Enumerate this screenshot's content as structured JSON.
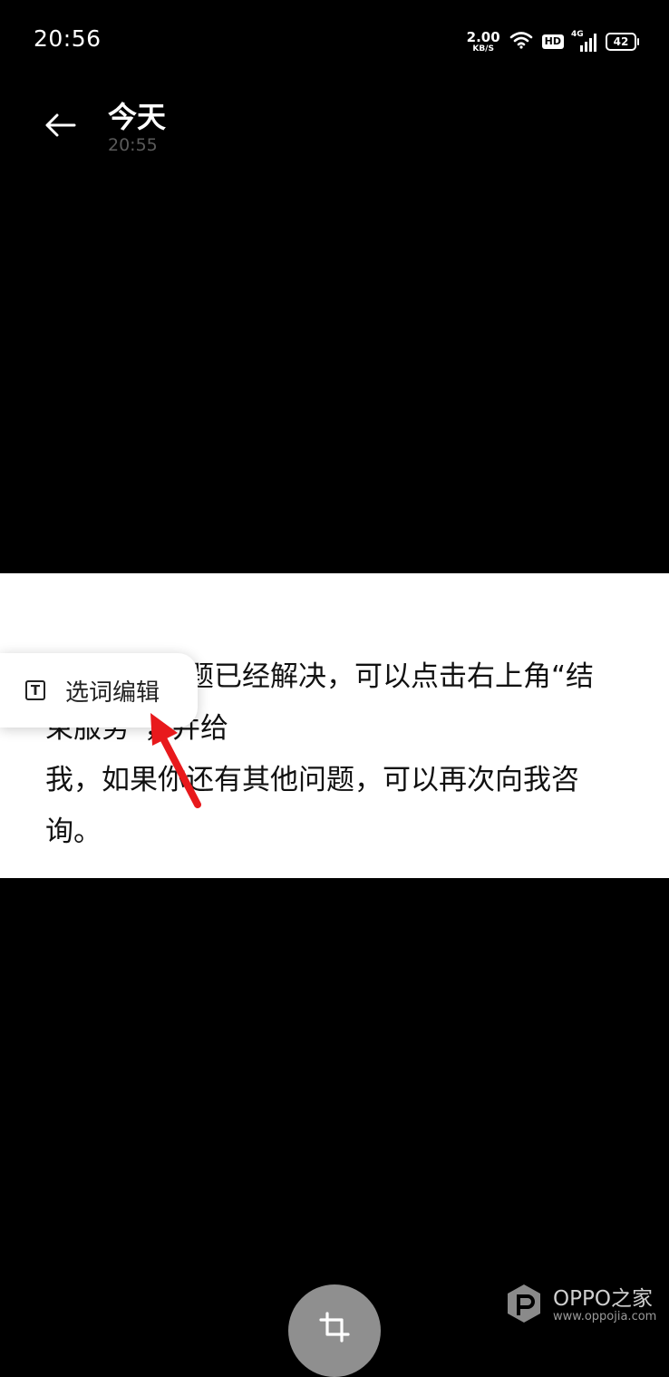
{
  "status_bar": {
    "time": "20:56",
    "net_speed_value": "2.00",
    "net_speed_unit": "KB/S",
    "hd_label": "HD",
    "network_label": "4G",
    "battery": "42",
    "icons": [
      "wifi-icon",
      "signal-icon",
      "battery-icon"
    ]
  },
  "header": {
    "title": "今天",
    "subtitle": "20:55",
    "back_icon": "back-arrow-icon"
  },
  "content": {
    "lines": [
      "如果您的问题已经解决，可以点击右上角“结",
      "束服务”，并给",
      "我，如果你还有其他问题，可以再次向我咨",
      "询。"
    ]
  },
  "popup": {
    "icon_glyph": "T",
    "label": "选词编辑"
  },
  "annotation": {
    "arrow_color": "#e8191c"
  },
  "toolbar": {
    "crop_icon": "crop-icon"
  },
  "watermark": {
    "brand": "OPPO之家",
    "url": "www.oppojia.com"
  }
}
